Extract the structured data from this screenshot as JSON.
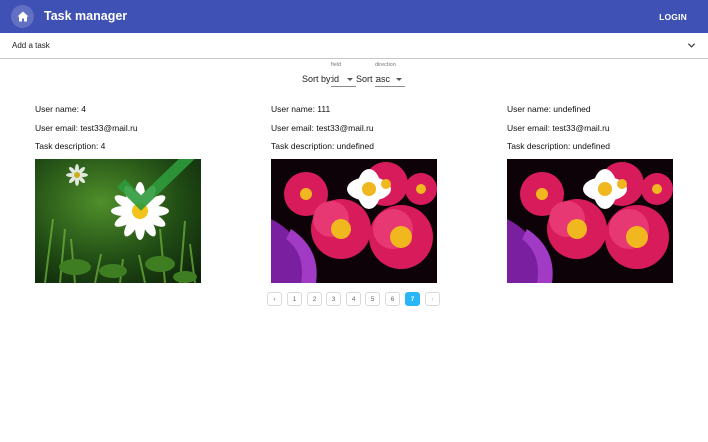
{
  "appbar": {
    "title": "Task manager",
    "login_label": "LOGIN",
    "home_icon": "home-icon",
    "color": "#3f51b5"
  },
  "add_task": {
    "label": "Add a task",
    "icon": "chevron-down-icon"
  },
  "sort": {
    "field_caption": "field",
    "field_label": "Sort by:",
    "field_value": "id",
    "direction_caption": "direction",
    "direction_label": "Sort :",
    "direction_value": "asc"
  },
  "tasks": [
    {
      "user_name": "User name: 4",
      "user_email": "User email: test33@mail.ru",
      "task_description": "Task description: 4",
      "image": "daisy-with-checkmark"
    },
    {
      "user_name": "User name: 111",
      "user_email": "User email: test33@mail.ru",
      "task_description": "Task description: undefined",
      "image": "red-daisies"
    },
    {
      "user_name": "User name: undefined",
      "user_email": "User email: test33@mail.ru",
      "task_description": "Task description: undefined",
      "image": "red-daisies"
    }
  ],
  "pagination": {
    "prev_label": "‹",
    "next_label": "›",
    "pages": [
      "1",
      "2",
      "3",
      "4",
      "5",
      "6",
      "7"
    ],
    "current": "7",
    "active_color": "#29b6f6"
  }
}
